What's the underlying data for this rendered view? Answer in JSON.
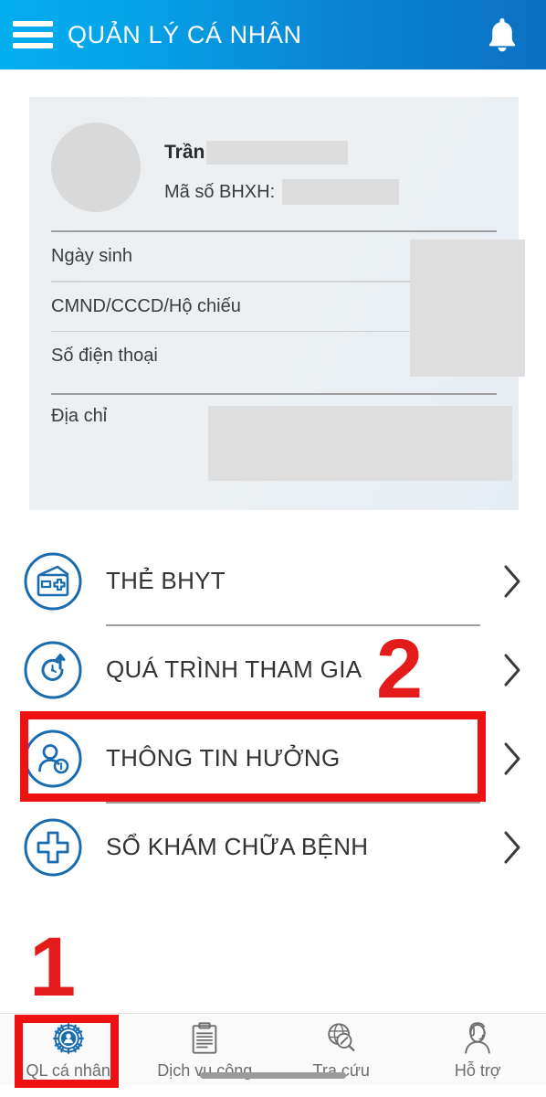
{
  "header": {
    "title": "QUẢN LÝ CÁ NHÂN",
    "menu_icon": "hamburger-icon",
    "notification_icon": "bell-icon"
  },
  "profile_card": {
    "name": "Trần",
    "name_redacted": true,
    "bhxh_label": "Mã số BHXH:",
    "bhxh_redacted": true,
    "fields": [
      {
        "label": "Ngày sinh",
        "value_redacted": true
      },
      {
        "label": "CMND/CCCD/Hộ chiếu",
        "value_redacted": true
      },
      {
        "label": "Số điện thoại",
        "value_redacted": true
      },
      {
        "label": "Địa chỉ",
        "value_redacted": true
      }
    ]
  },
  "menu": {
    "items": [
      {
        "label": "THẺ BHYT",
        "icon": "health-insurance-card-icon",
        "highlighted": false
      },
      {
        "label": "QUÁ TRÌNH THAM GIA",
        "icon": "history-clock-icon",
        "highlighted": false
      },
      {
        "label": "THÔNG TIN HƯỞNG",
        "icon": "person-info-icon",
        "highlighted": true
      },
      {
        "label": "SỔ KHÁM CHỮA BỆNH",
        "icon": "medical-cross-icon",
        "highlighted": false
      }
    ],
    "chevron_icon": "chevron-right-icon"
  },
  "bottom_nav": {
    "items": [
      {
        "label": "QL cá nhân",
        "icon": "gear-person-icon",
        "active": true
      },
      {
        "label": "Dịch vụ công",
        "icon": "clipboard-document-icon",
        "active": false
      },
      {
        "label": "Tra cứu",
        "icon": "globe-search-icon",
        "active": false
      },
      {
        "label": "Hỗ trợ",
        "icon": "headset-support-icon",
        "active": false
      }
    ]
  },
  "annotations": [
    {
      "number": "1",
      "target": "QL cá nhân",
      "color": "#e31b1b"
    },
    {
      "number": "2",
      "target": "THÔNG TIN HƯỞNG",
      "color": "#e31b1b"
    }
  ],
  "colors": {
    "header_left": "#03AEEF",
    "header_right": "#0C71C3",
    "icon_blue": "#1a6cb0",
    "annotation_red": "#ee1111",
    "card_bg": "#eceff1"
  }
}
